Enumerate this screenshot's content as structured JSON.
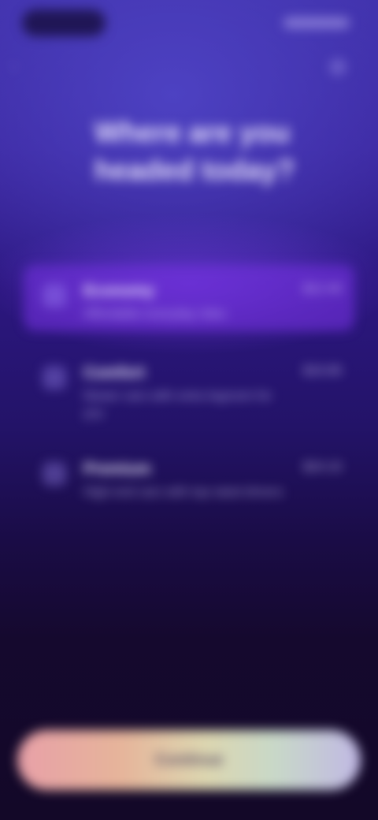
{
  "header": {
    "title": "Where are you headed today?"
  },
  "options": [
    {
      "name": "Economy",
      "description": "Affordable everyday rides",
      "price": "$12.40"
    },
    {
      "name": "Comfort",
      "description": "Newer cars with extra legroom for you",
      "price": "$16.80"
    },
    {
      "name": "Premium",
      "description": "High-end cars with top-rated drivers",
      "price": "$24.10"
    }
  ],
  "cta": {
    "label": "Continue"
  },
  "colors": {
    "background_top": "#3f2fa8",
    "background_bottom": "#130828",
    "selected_option": "#7832e6",
    "button_gradient_start": "#e8a0a8",
    "button_gradient_end": "#c0b8e4"
  }
}
